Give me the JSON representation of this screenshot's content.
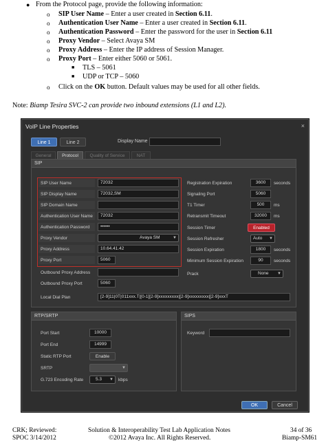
{
  "instructions": {
    "intro": "From the Protocol page, provide the following information:",
    "items": [
      {
        "bold": "SIP User Name",
        "text": " – Enter a user created in ",
        "ref": "Section 6.11",
        "end": "."
      },
      {
        "bold": "Authentication User Name",
        "text": " – Enter a user created in ",
        "ref": "Section 6.11",
        "end": "."
      },
      {
        "bold": "Authentication Password",
        "text": " – Enter the password for the user in ",
        "ref": "Section 6.11",
        "end": ""
      },
      {
        "bold": "Proxy Vendor",
        "text": " – Select Avaya SM",
        "ref": "",
        "end": ""
      },
      {
        "bold": "Proxy Address",
        "text": " – Enter the IP address of Session Manager.",
        "ref": "",
        "end": ""
      },
      {
        "bold": "Proxy Port",
        "text": " – Enter either 5060 or 5061.",
        "ref": "",
        "end": ""
      }
    ],
    "sub_items": [
      "TLS – 5061",
      "UDP or TCP – 5060"
    ],
    "last_pre": "Click on the ",
    "last_bold": "OK",
    "last_post": " button. Default values may be used for all other fields."
  },
  "note": {
    "label": "Note: ",
    "text": "Biamp Tesira SVC-2 can provide two inbound extensions (L1 and L2)."
  },
  "dialog": {
    "title": "VoIP Line Properties",
    "close": "×",
    "line_tabs": [
      "Line 1",
      "Line 2"
    ],
    "display_name_label": "Display Name",
    "display_name_value": "",
    "sub_tabs": [
      "General",
      "Protocol",
      "Quality of Service",
      "NAT"
    ],
    "sip_header": "SIP",
    "left_fields": [
      {
        "label": "SIP User Name",
        "value": "72032"
      },
      {
        "label": "SIP Display Name",
        "value": "72032,SM"
      },
      {
        "label": "SIP Domain Name",
        "value": ""
      },
      {
        "label": "Authentication User Name",
        "value": "72032"
      },
      {
        "label": "Authentication Password",
        "value": "••••••"
      },
      {
        "label": "Proxy Vendor",
        "value": "Avaya SM"
      },
      {
        "label": "Proxy Address",
        "value": "10.64.41.42"
      },
      {
        "label": "Proxy Port",
        "value": "5060"
      },
      {
        "label": "Outbound Proxy Address",
        "value": ""
      },
      {
        "label": "Outbound Proxy Port",
        "value": "5060"
      }
    ],
    "dial_plan_label": "Local Dial Plan",
    "dial_plan_value": "[2-9]11|0T|011xxx.T|[0-1][2-9]xxxxxxxxx|[2-9]xxxxxxxxx|[2-9]xxxT",
    "right_fields": [
      {
        "label": "Registration Expiration",
        "value": "3600",
        "unit": "seconds"
      },
      {
        "label": "Signaling Port",
        "value": "5060",
        "unit": ""
      },
      {
        "label": "T1 Timer",
        "value": "500",
        "unit": "ms"
      },
      {
        "label": "Retransmit Timeout",
        "value": "32000",
        "unit": "ms"
      },
      {
        "label": "Session Timer",
        "value": "Enabled",
        "unit": ""
      },
      {
        "label": "Session Refresher",
        "value": "Auto",
        "unit": ""
      },
      {
        "label": "Session Expiration",
        "value": "1800",
        "unit": "seconds"
      },
      {
        "label": "Minimum Session Expiration",
        "value": "90",
        "unit": "seconds"
      },
      {
        "label": "Prack",
        "value": "None",
        "unit": ""
      }
    ],
    "rtp_header": "RTP/SRTP",
    "rtp_fields": [
      {
        "label": "Port Start",
        "value": "10000"
      },
      {
        "label": "Port End",
        "value": "14999"
      },
      {
        "label": "Static RTP Port",
        "value": "Enable"
      },
      {
        "label": "SRTP",
        "value": ""
      },
      {
        "label": "G.723 Encoding Rate",
        "value": "5.3",
        "unit": "kbps"
      }
    ],
    "sips_header": "SIPS",
    "keyword_label": "Keyword",
    "keyword_value": "",
    "ok": "OK",
    "cancel": "Cancel"
  },
  "footer": {
    "left1": "CRK; Reviewed:",
    "left2": "SPOC 3/14/2012",
    "center1": "Solution & Interoperability Test Lab Application Notes",
    "center2": "©2012 Avaya Inc. All Rights Reserved.",
    "right1": "34 of 36",
    "right2": "Biamp-SM61"
  }
}
